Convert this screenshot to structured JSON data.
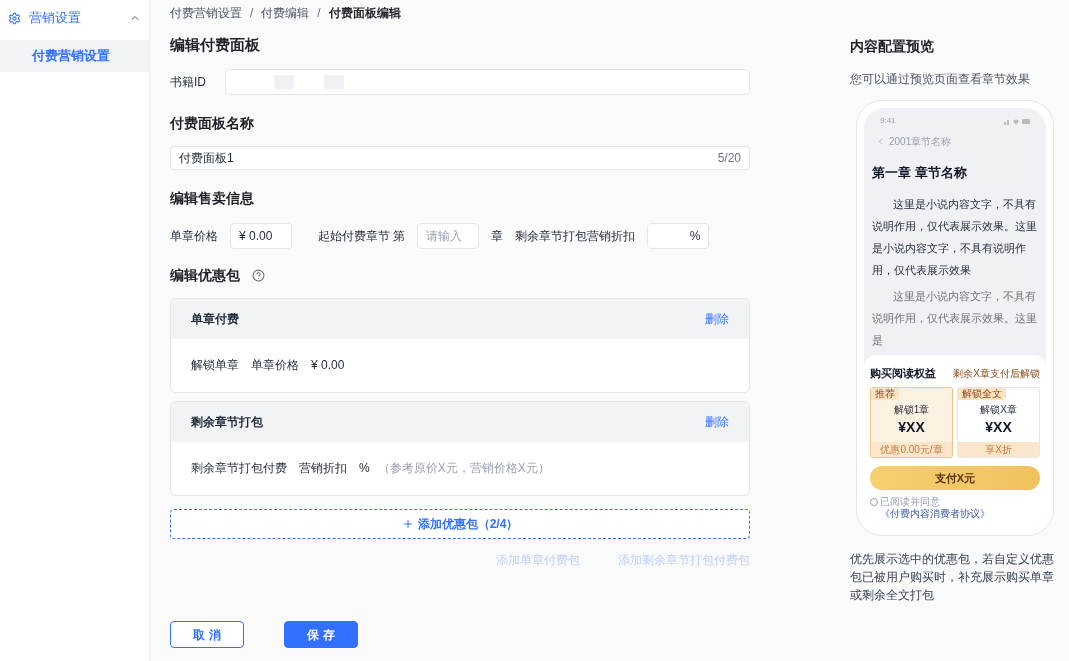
{
  "sidebar": {
    "group": {
      "label": "营销设置",
      "expanded": true
    },
    "items": [
      {
        "label": "付费营销设置",
        "selected": true
      }
    ]
  },
  "breadcrumb": {
    "separator": "/",
    "items": [
      {
        "label": "付费营销设置",
        "current": false
      },
      {
        "label": "付费编辑",
        "current": false
      },
      {
        "label": "付费面板编辑",
        "current": true
      }
    ]
  },
  "page_title": "编辑付费面板",
  "book_id": {
    "label": "书籍ID"
  },
  "panel_name": {
    "title": "付费面板名称",
    "value": "付费面板1",
    "counter": "5/20"
  },
  "sale_info": {
    "title": "编辑售卖信息",
    "price": {
      "label": "单章价格",
      "value": "¥ 0.00"
    },
    "start_chapter": {
      "label": "起始付费章节 第",
      "placeholder": "请输入",
      "suffix": "章"
    },
    "discount": {
      "label": "剩余章节打包营销折扣",
      "suffix": "%"
    }
  },
  "packages": {
    "title": "编辑优惠包",
    "items": [
      {
        "title": "单章付费",
        "action": "删除",
        "parts": [
          {
            "kind": "label",
            "text": "解锁单章"
          },
          {
            "kind": "label",
            "text": "单章价格"
          },
          {
            "kind": "value",
            "text": "¥ 0.00"
          }
        ]
      },
      {
        "title": "剩余章节打包",
        "action": "删除",
        "parts": [
          {
            "kind": "label",
            "text": "剩余章节打包付费"
          },
          {
            "kind": "label",
            "text": "营销折扣"
          },
          {
            "kind": "value",
            "text": "%"
          },
          {
            "kind": "hint",
            "text": "（参考原价X元，营销价格X元）"
          }
        ]
      }
    ],
    "add_button": "添加优惠包（2/4）",
    "quick_adds": [
      {
        "label": "添加单章付费包",
        "disabled": true
      },
      {
        "label": "添加剩余章节打包付费包",
        "disabled": true
      }
    ]
  },
  "actions": [
    {
      "label": "取消",
      "primary": false
    },
    {
      "label": "保存",
      "primary": true
    }
  ],
  "preview": {
    "title": "内容配置预览",
    "subtitle": "您可以通过预览页面查看章节效果",
    "phone": {
      "time": "9:41",
      "back": "2001章节名称",
      "chapter_title": "第一章 章节名称",
      "paragraphs": [
        {
          "text": "这里是小说内容文字，不具有说明作用，仅代表展示效果。这里是小说内容文字，不具有说明作用，仅代表展示效果",
          "faded": false
        },
        {
          "text": "这里是小说内容文字，不具有说明作用，仅代表展示效果。这里是",
          "faded": true
        }
      ],
      "purchase": {
        "title": "购买阅读权益",
        "note": "剩余X章支付后解锁",
        "options": [
          {
            "tag": "推荐",
            "name": "解锁1章",
            "price": "¥XX",
            "footer": "优惠0.00元/章",
            "selected": true
          },
          {
            "tag": "解锁全文",
            "name": "解锁X章",
            "price": "¥XX",
            "footer": "享X折",
            "selected": false
          }
        ],
        "pay_button": "支付X元",
        "agreement": {
          "checked": false,
          "text": "已阅读并同意",
          "link": "《付费内容消费者协议》"
        }
      }
    },
    "note": "优先展示选中的优惠包，若自定义优惠包已被用户购买时，补充展示购买单章或剩余全文打包"
  }
}
